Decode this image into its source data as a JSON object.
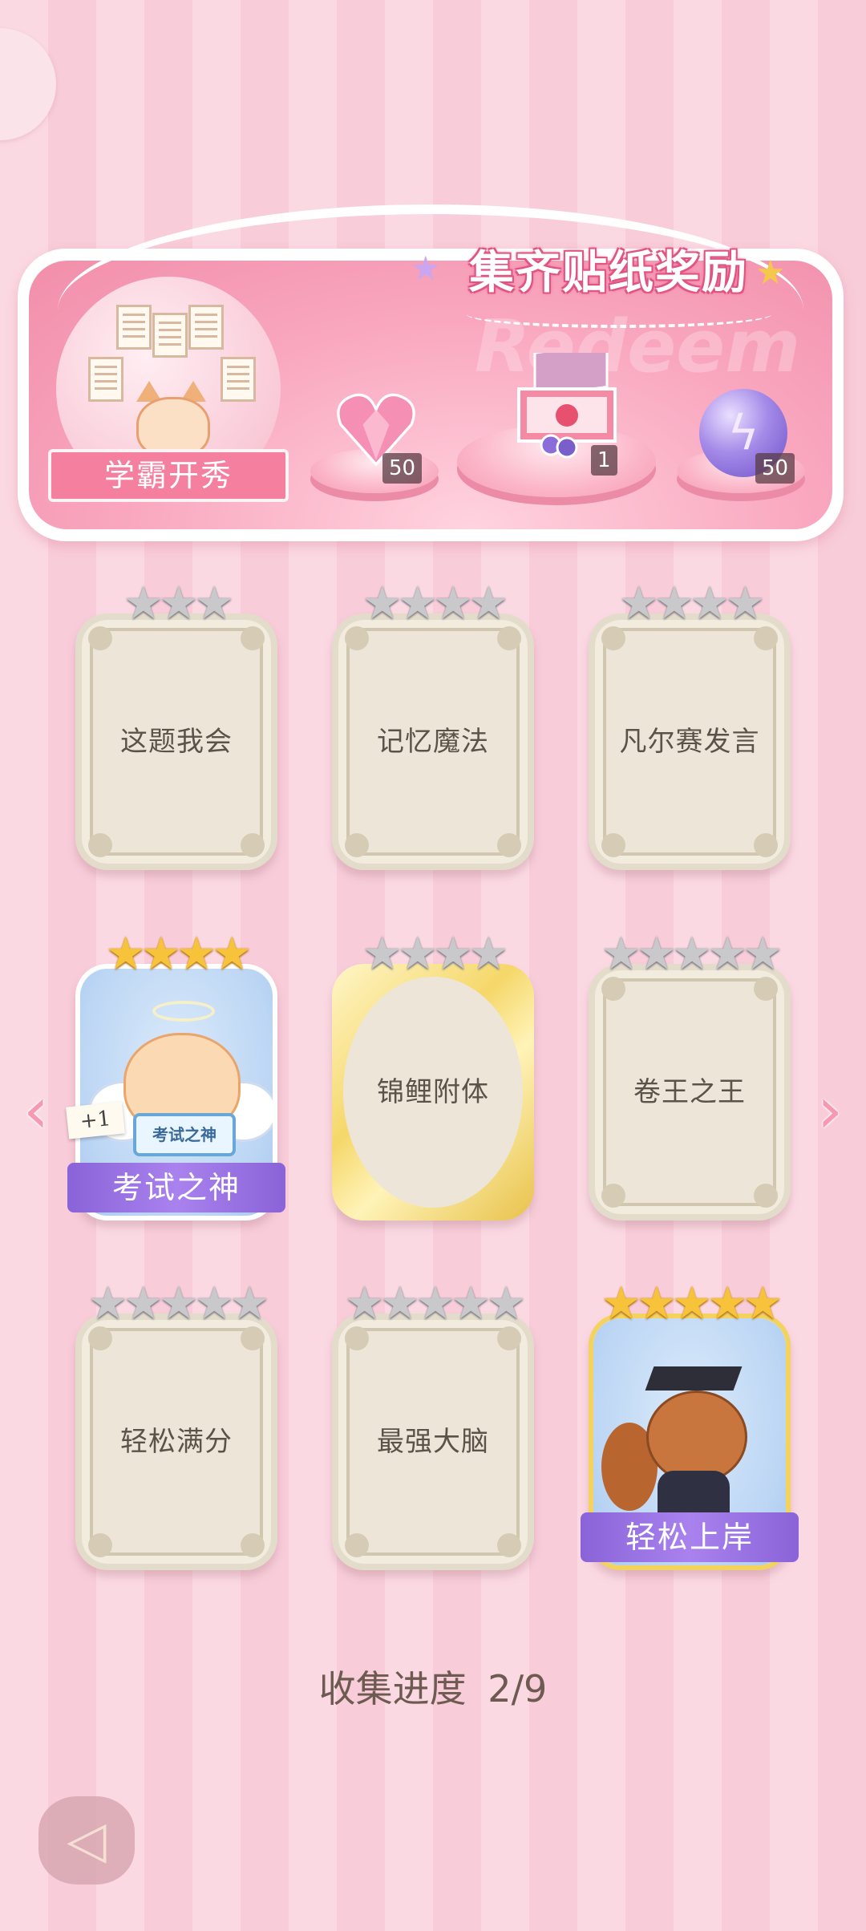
{
  "banner": {
    "title": "集齐贴纸奖励",
    "watermark": "Redeem",
    "ribbon_label": "学霸开秀",
    "rewards": [
      {
        "icon": "heart-gem-icon",
        "count": "50"
      },
      {
        "icon": "gift-box-icon",
        "count": "1"
      },
      {
        "icon": "energy-orb-icon",
        "count": "50"
      }
    ]
  },
  "stickers": [
    {
      "name": "这题我会",
      "stars": "★★★",
      "collected": false
    },
    {
      "name": "记忆魔法",
      "stars": "★★★★",
      "collected": false
    },
    {
      "name": "凡尔赛发言",
      "stars": "★★★★",
      "collected": false
    },
    {
      "name": "考试之神",
      "stars": "★★★★",
      "collected": true,
      "sign_text": "考试之神",
      "extra_badge": "+1"
    },
    {
      "name": "锦鲤附体",
      "stars": "★★★★",
      "collected": false
    },
    {
      "name": "卷王之王",
      "stars": "★★★★★",
      "collected": false
    },
    {
      "name": "轻松满分",
      "stars": "★★★★★",
      "collected": false
    },
    {
      "name": "最强大脑",
      "stars": "★★★★★",
      "collected": false
    },
    {
      "name": "轻松上岸",
      "stars": "★★★★★",
      "collected": true
    }
  ],
  "nav": {
    "prev": "‹",
    "next": "›",
    "back": "◁"
  },
  "progress": {
    "label": "收集进度",
    "value": "2/9"
  },
  "colors": {
    "accent_pink": "#f57f9e",
    "banner_purple": "#8a63d8",
    "star_gold": "#f6c33a",
    "star_silver": "#c9c9cc"
  }
}
